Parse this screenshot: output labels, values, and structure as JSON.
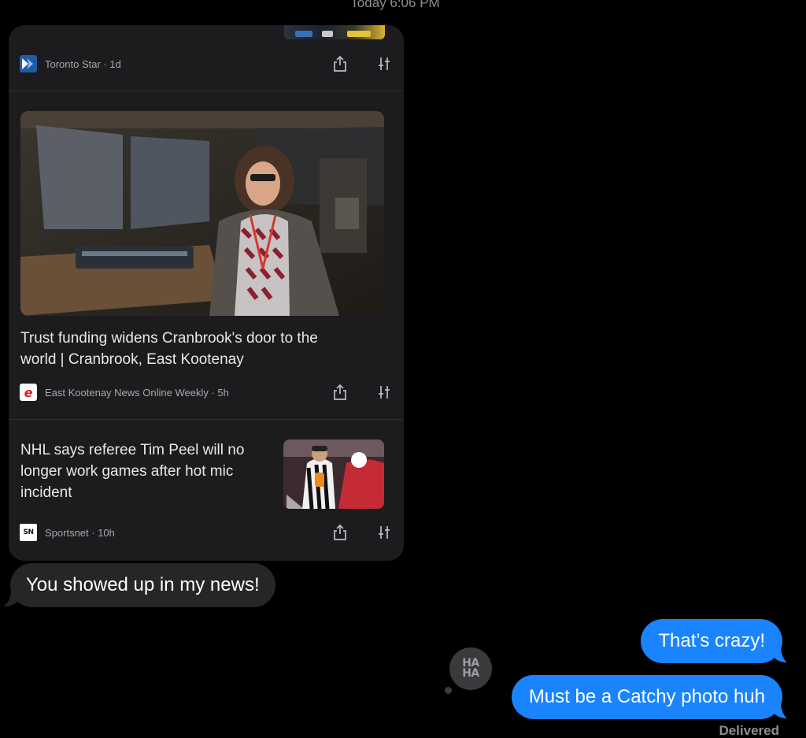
{
  "conversation": {
    "timestamp": "Today 6:06 PM"
  },
  "news_card": {
    "items": [
      {
        "source": "Toronto Star · 1d",
        "logo_icon": "toronto-star-logo"
      },
      {
        "headline_line1": "Trust funding widens Cranbrook's door to the",
        "headline_line2": "world | Cranbrook, East Kootenay",
        "source": "East Kootenay News Online Weekly · 5h",
        "logo_icon": "ek-news-logo",
        "logo_text": "e"
      },
      {
        "headline_line1": "NHL says referee Tim Peel will no",
        "headline_line2": "longer work games after hot mic",
        "headline_line3": "incident",
        "source": "Sportsnet · 10h",
        "logo_icon": "sportsnet-logo",
        "logo_text": "SN"
      }
    ],
    "actions": {
      "share_icon": "share-icon",
      "more_icon": "sort-options-icon"
    }
  },
  "messages": {
    "incoming": "You showed up in my news!",
    "outgoing_1": "That’s crazy!",
    "outgoing_2": "Must be a Catchy photo huh",
    "tapback_line1": "HA",
    "tapback_line2": "HA",
    "status": "Delivered"
  },
  "colors": {
    "background": "#000000",
    "incoming_bubble": "#262628",
    "outgoing_bubble": "#1a84ff",
    "card_background": "#1c1c1e"
  }
}
